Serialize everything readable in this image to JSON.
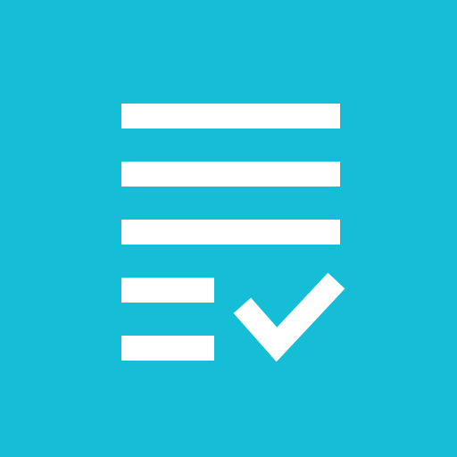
{
  "icon": {
    "name": "checklist-icon",
    "background_color": "#16BDD6",
    "foreground_color": "#FFFFFF"
  }
}
